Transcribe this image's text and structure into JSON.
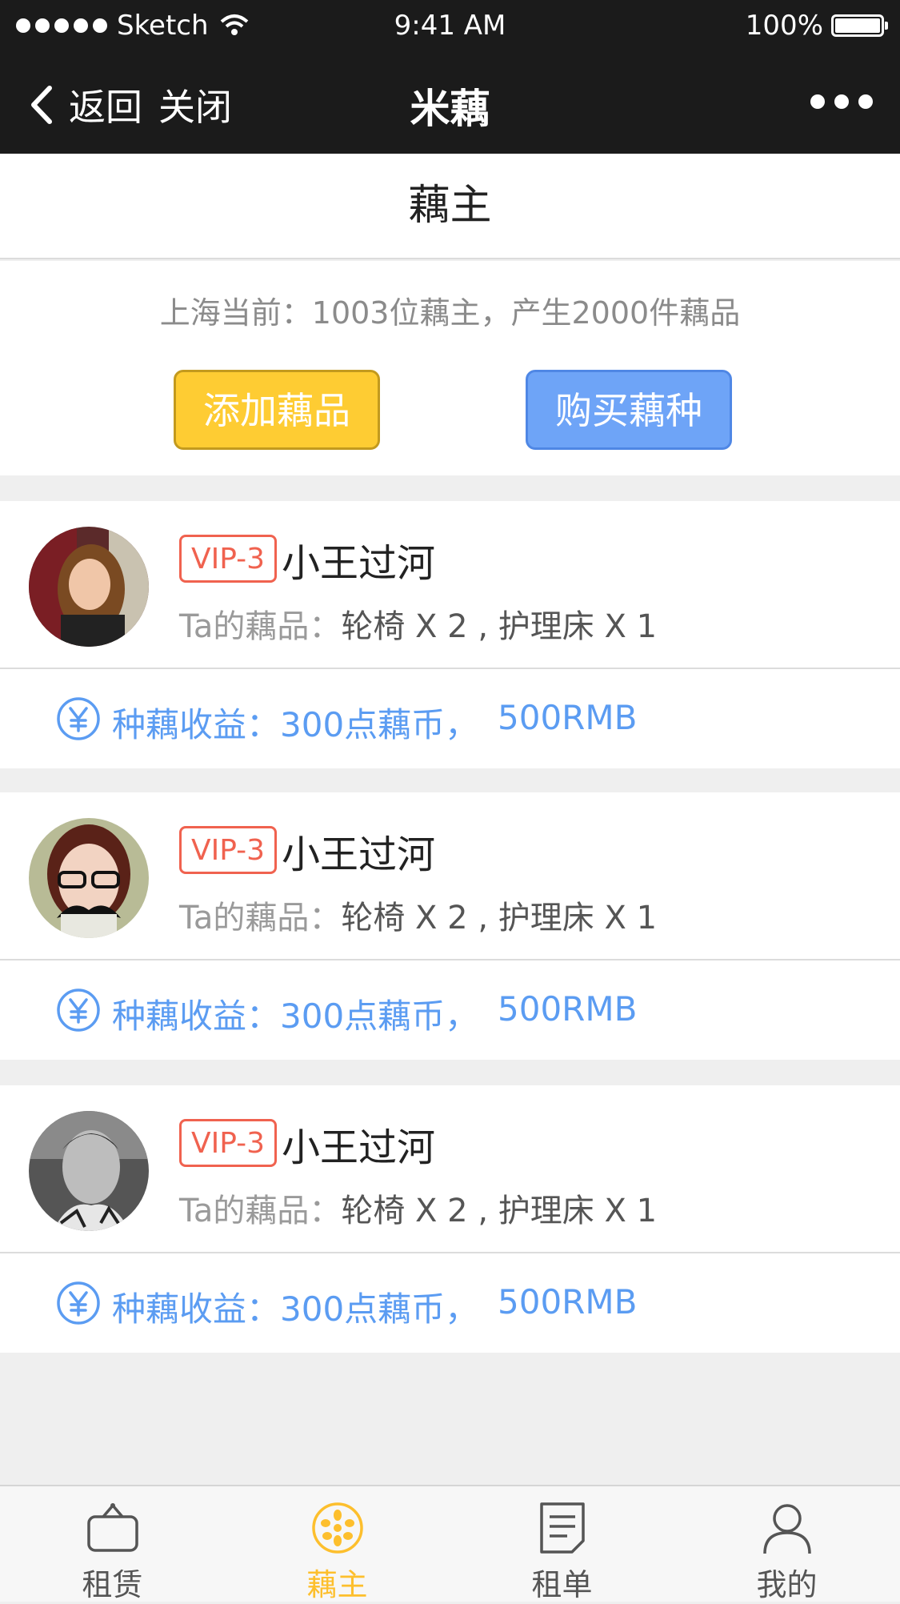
{
  "status_bar": {
    "carrier": "Sketch",
    "time": "9:41 AM",
    "battery": "100%"
  },
  "nav": {
    "back_label": "返回",
    "close_label": "关闭",
    "title": "米藕"
  },
  "header": {
    "title": "藕主"
  },
  "summary": {
    "text": "上海当前：1003位藕主，产生2000件藕品",
    "add_button": "添加藕品",
    "buy_button": "购买藕种"
  },
  "cards": [
    {
      "vip": "VIP-3",
      "name": "小王过河",
      "items_label": "Ta的藕品：",
      "items": "轮椅 X 2 , 护理床 X 1",
      "earnings": "种藕收益：300点藕币，",
      "rmb": "500RMB"
    },
    {
      "vip": "VIP-3",
      "name": "小王过河",
      "items_label": "Ta的藕品：",
      "items": "轮椅 X 2 , 护理床 X 1",
      "earnings": "种藕收益：300点藕币，",
      "rmb": "500RMB"
    },
    {
      "vip": "VIP-3",
      "name": "小王过河",
      "items_label": "Ta的藕品：",
      "items": "轮椅 X 2 , 护理床 X 1",
      "earnings": "种藕收益：300点藕币，",
      "rmb": "500RMB"
    }
  ],
  "tabs": [
    {
      "label": "租赁",
      "icon": "bag-icon"
    },
    {
      "label": "藕主",
      "icon": "lotus-root-icon"
    },
    {
      "label": "租单",
      "icon": "order-list-icon"
    },
    {
      "label": "我的",
      "icon": "user-icon"
    }
  ],
  "colors": {
    "accent": "#fdbf2d",
    "blue": "#5b9cf2",
    "vip": "#f0624f",
    "add_button": "#fecc33",
    "buy_button": "#6ea4f7"
  }
}
